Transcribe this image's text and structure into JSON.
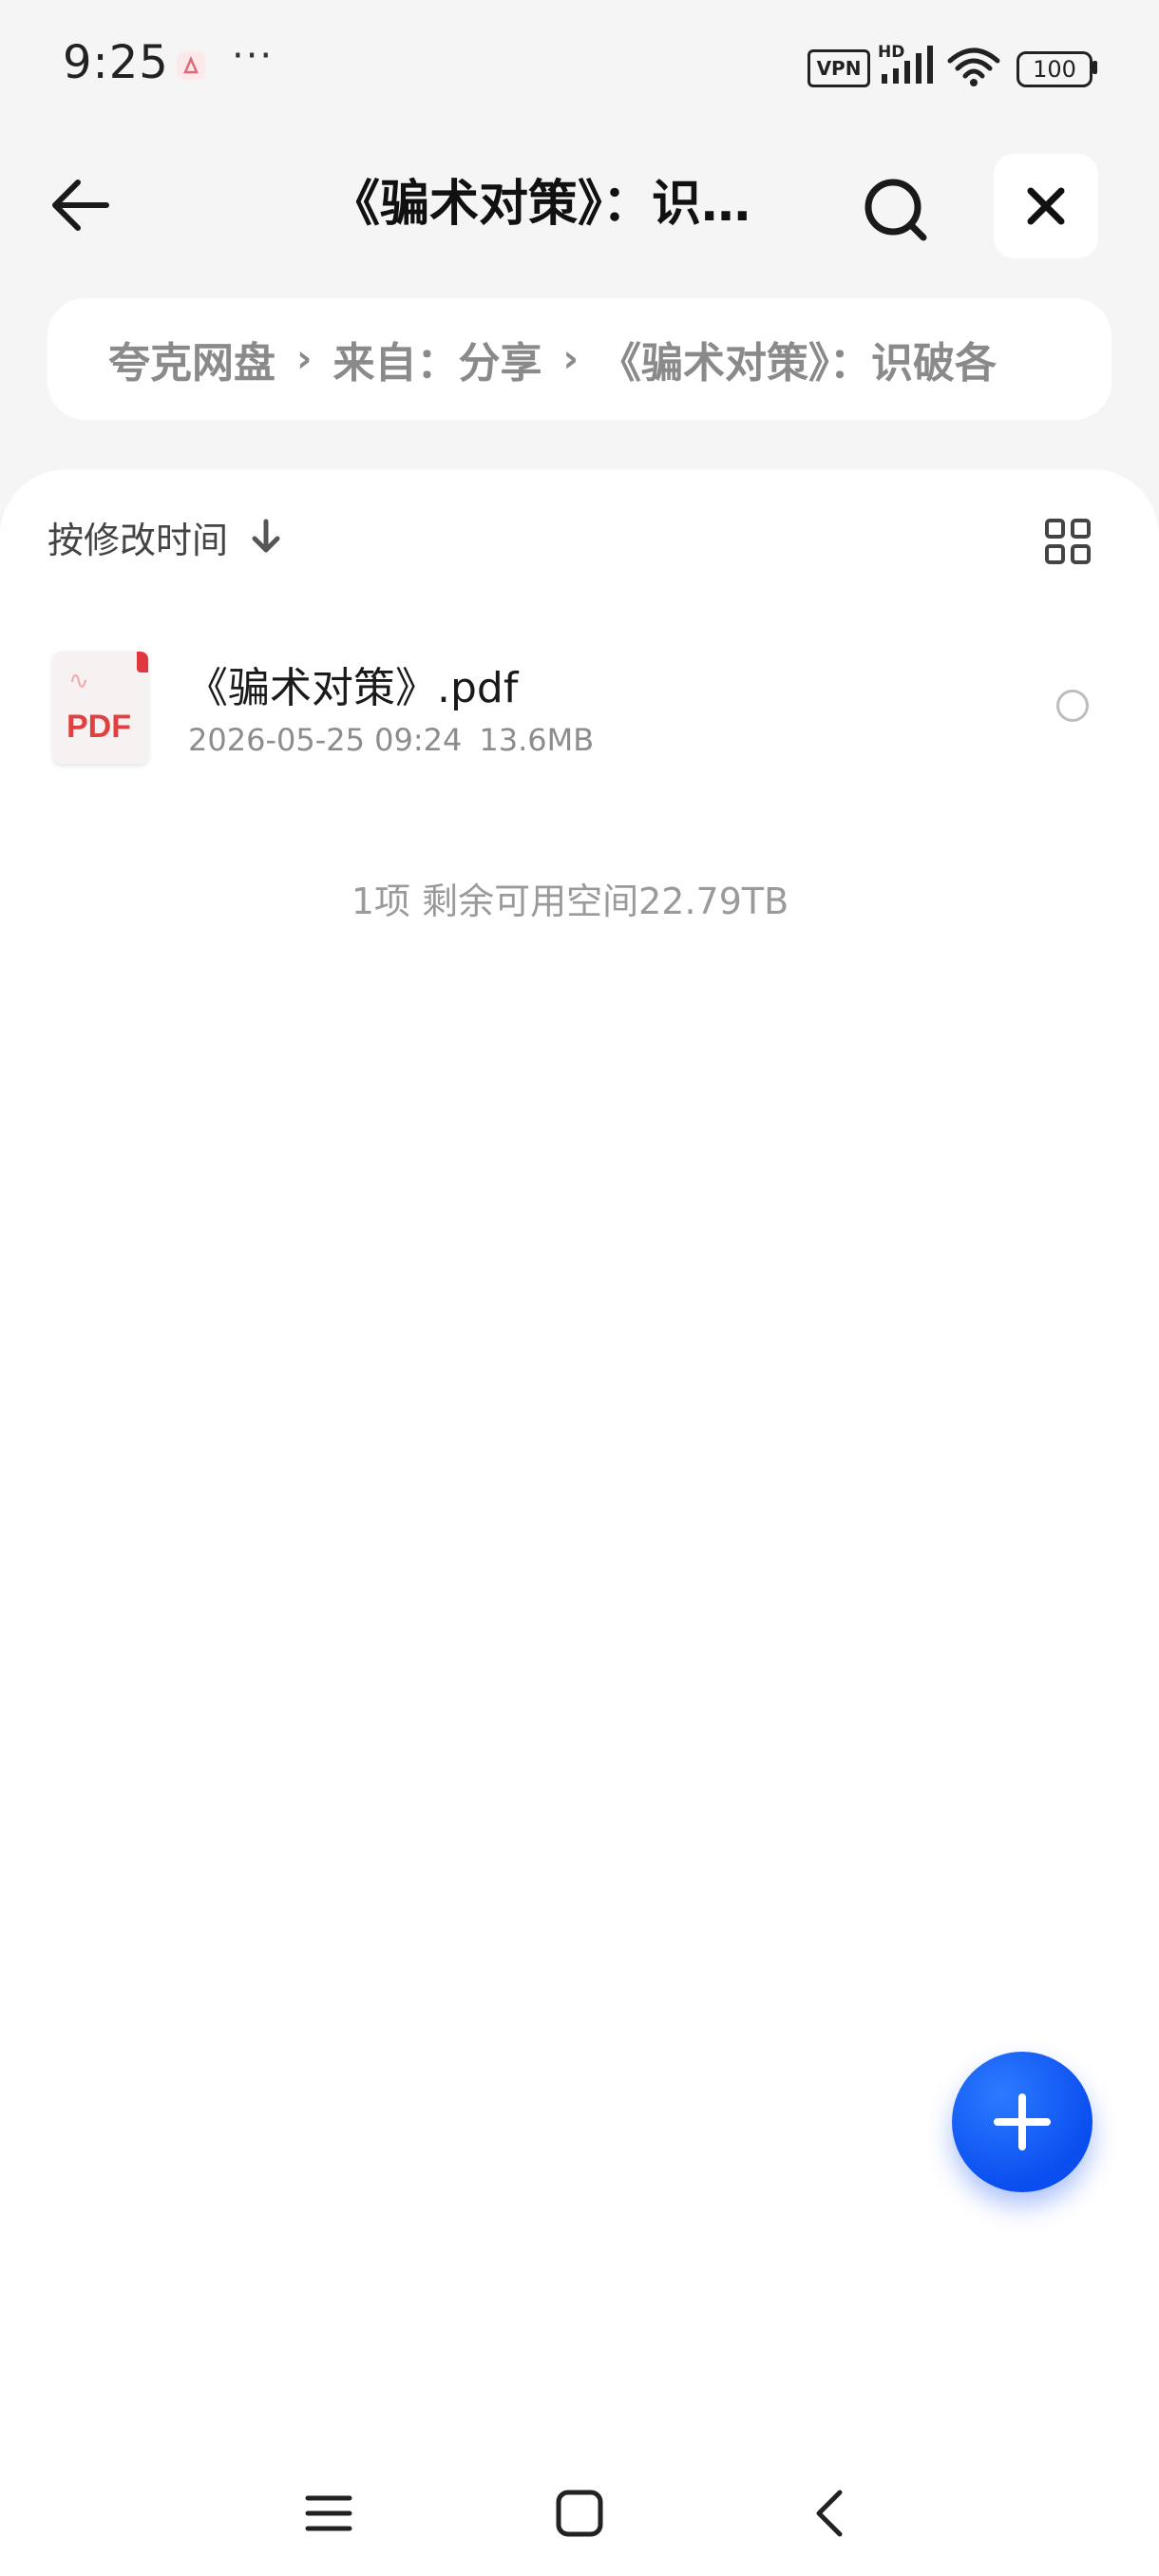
{
  "status_bar": {
    "time": "9:25",
    "more": "···",
    "vpn": "VPN",
    "network": "HD",
    "battery": "100"
  },
  "header": {
    "title": "《骗术对策》：识…",
    "back_icon": "arrow-left-icon",
    "search_icon": "search-icon",
    "close_icon": "close-icon"
  },
  "breadcrumb": {
    "items": [
      "夸克网盘",
      "来自：分享",
      "《骗术对策》：识破各"
    ],
    "separator_icon": "chevron-right-icon"
  },
  "sort": {
    "label": "按修改时间",
    "direction_icon": "arrow-down-icon",
    "view_icon": "grid-view-icon"
  },
  "files": [
    {
      "name": "《骗术对策》.pdf",
      "date": "2026-05-25 09:24",
      "size": "13.6MB",
      "type_label": "PDF",
      "icon": "pdf-file-icon",
      "selected": false
    }
  ],
  "summary": "1项 剩余可用空间22.79TB",
  "fab": {
    "icon": "plus-icon",
    "color": "#0a55f5"
  },
  "nav_bar": {
    "icons": [
      "menu-icon",
      "home-icon",
      "back-icon"
    ]
  }
}
